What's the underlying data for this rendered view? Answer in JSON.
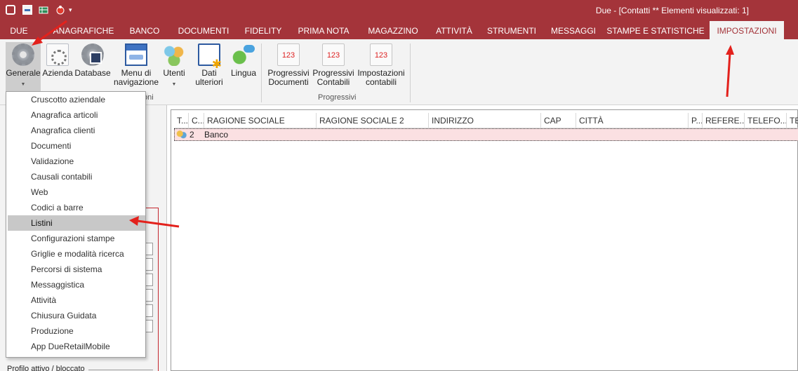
{
  "window": {
    "title": "Due - [Contatti ** Elementi visualizzati: 1]"
  },
  "quick_access": [
    {
      "icon": "app-logo-icon"
    },
    {
      "icon": "calculator-icon"
    },
    {
      "icon": "grid-icon"
    },
    {
      "icon": "bug-icon"
    },
    {
      "icon": "dropdown-arrow-icon",
      "glyph": "▾"
    }
  ],
  "tabs": [
    {
      "label": "DUE"
    },
    {
      "label": "ANAGRAFICHE"
    },
    {
      "label": "BANCO"
    },
    {
      "label": "DOCUMENTI"
    },
    {
      "label": "FIDELITY"
    },
    {
      "label": "PRIMA NOTA"
    },
    {
      "label": "MAGAZZINO"
    },
    {
      "label": "ATTIVITÀ"
    },
    {
      "label": "STRUMENTI"
    },
    {
      "label": "MESSAGGI"
    },
    {
      "label": "STAMPE E STATISTICHE"
    },
    {
      "label": "IMPOSTAZIONI",
      "active": true
    }
  ],
  "ribbon": {
    "buttons": [
      {
        "label": "Generale",
        "icon": "gear-icon",
        "dropdown": true,
        "pressed": true
      },
      {
        "label": "Azienda",
        "icon": "document-gear-icon"
      },
      {
        "label": "Database",
        "icon": "database-gear-icon"
      },
      {
        "label": "Menu di navigazione",
        "icon": "navigation-menu-icon"
      },
      {
        "label": "Utenti",
        "icon": "users-icon",
        "dropdown": true
      },
      {
        "label": "Dati ulteriori",
        "icon": "extra-data-icon",
        "dropdown": true
      },
      {
        "label": "Lingua",
        "icon": "language-icon"
      },
      {
        "label": "Progressivi Documenti",
        "icon": "counter-123-icon"
      },
      {
        "label": "Progressivi Contabili",
        "icon": "counter-123-icon"
      },
      {
        "label": "Impostazioni contabili",
        "icon": "counter-123-icon"
      }
    ],
    "groups": [
      {
        "label": "oni"
      },
      {
        "label": "Progressivi"
      }
    ]
  },
  "menu": {
    "items": [
      {
        "label": "Cruscotto aziendale"
      },
      {
        "label": "Anagrafica articoli"
      },
      {
        "label": "Anagrafica clienti"
      },
      {
        "label": "Documenti"
      },
      {
        "label": "Validazione"
      },
      {
        "label": "Causali contabili"
      },
      {
        "label": "Web"
      },
      {
        "label": "Codici a barre"
      },
      {
        "label": "Listini",
        "highlighted": true
      },
      {
        "label": "Configurazioni stampe"
      },
      {
        "label": "Griglie e modalità ricerca"
      },
      {
        "label": "Percorsi di sistema"
      },
      {
        "label": "Messaggistica"
      },
      {
        "label": "Attività"
      },
      {
        "label": "Chiusura Guidata"
      },
      {
        "label": "Produzione"
      },
      {
        "label": "App DueRetailMobile"
      }
    ]
  },
  "left_panel": {
    "profile_label": "Profilo attivo / bloccato"
  },
  "grid": {
    "columns": [
      "T...",
      "C...",
      "RAGIONE SOCIALE",
      "RAGIONE SOCIALE 2",
      "INDIRIZZO",
      "CAP",
      "CITTÀ",
      "P...",
      "REFERE...",
      "TELEFO...",
      "TE"
    ],
    "rows": [
      {
        "code": "2",
        "ragione_sociale": "Banco"
      }
    ]
  },
  "colors": {
    "brand": "#a4343a",
    "ribbon_bg": "#f3f3f3",
    "menu_highlight": "#c8c8c8",
    "selected_row": "#fbe0e2",
    "annotation_arrow": "#e3211c"
  }
}
